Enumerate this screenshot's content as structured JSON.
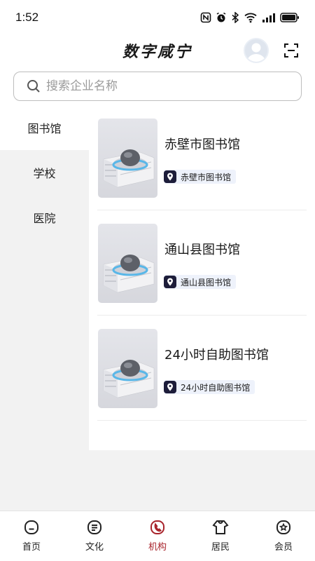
{
  "status_bar": {
    "time": "1:52"
  },
  "header": {
    "title": "数字咸宁"
  },
  "search": {
    "placeholder": "搜索企业名称"
  },
  "categories": [
    {
      "label": "图书馆",
      "active": true
    },
    {
      "label": "学校",
      "active": false
    },
    {
      "label": "医院",
      "active": false
    }
  ],
  "organizations": [
    {
      "name": "赤壁市图书馆",
      "tag": "赤壁市图书馆"
    },
    {
      "name": "通山县图书馆",
      "tag": "通山县图书馆"
    },
    {
      "name": "24小时自助图书馆",
      "tag": "24小时自助图书馆"
    }
  ],
  "tabs": [
    {
      "label": "首页",
      "icon": "home-icon",
      "active": false
    },
    {
      "label": "文化",
      "icon": "culture-icon",
      "active": false
    },
    {
      "label": "机构",
      "icon": "institution-icon",
      "active": true
    },
    {
      "label": "居民",
      "icon": "resident-icon",
      "active": false
    },
    {
      "label": "会员",
      "icon": "member-icon",
      "active": false
    }
  ],
  "colors": {
    "accent": "#a8232b",
    "tag_bg": "#eef2fb",
    "tag_icon_bg": "#1d1d3a",
    "sidebar_bg": "#f2f2f2"
  }
}
